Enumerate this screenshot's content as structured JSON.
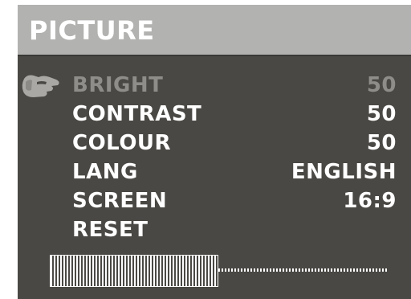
{
  "header": {
    "title": "PICTURE"
  },
  "menu": {
    "items": [
      {
        "label": "BRIGHT",
        "value": "50",
        "selected": true
      },
      {
        "label": "CONTRAST",
        "value": "50",
        "selected": false
      },
      {
        "label": "COLOUR",
        "value": "50",
        "selected": false
      },
      {
        "label": "LANG",
        "value": "ENGLISH",
        "selected": false
      },
      {
        "label": "SCREEN",
        "value": "16:9",
        "selected": false
      },
      {
        "label": "RESET",
        "value": "",
        "selected": false
      }
    ]
  },
  "level_bar": {
    "level_percent": 50
  },
  "colors": {
    "panel": "#4a4844",
    "title_bar": "#b2b2b0",
    "text": "#ffffff",
    "selected_text": "#8e8d89"
  },
  "icons": {
    "selection_pointer": "pointing-hand-icon"
  }
}
